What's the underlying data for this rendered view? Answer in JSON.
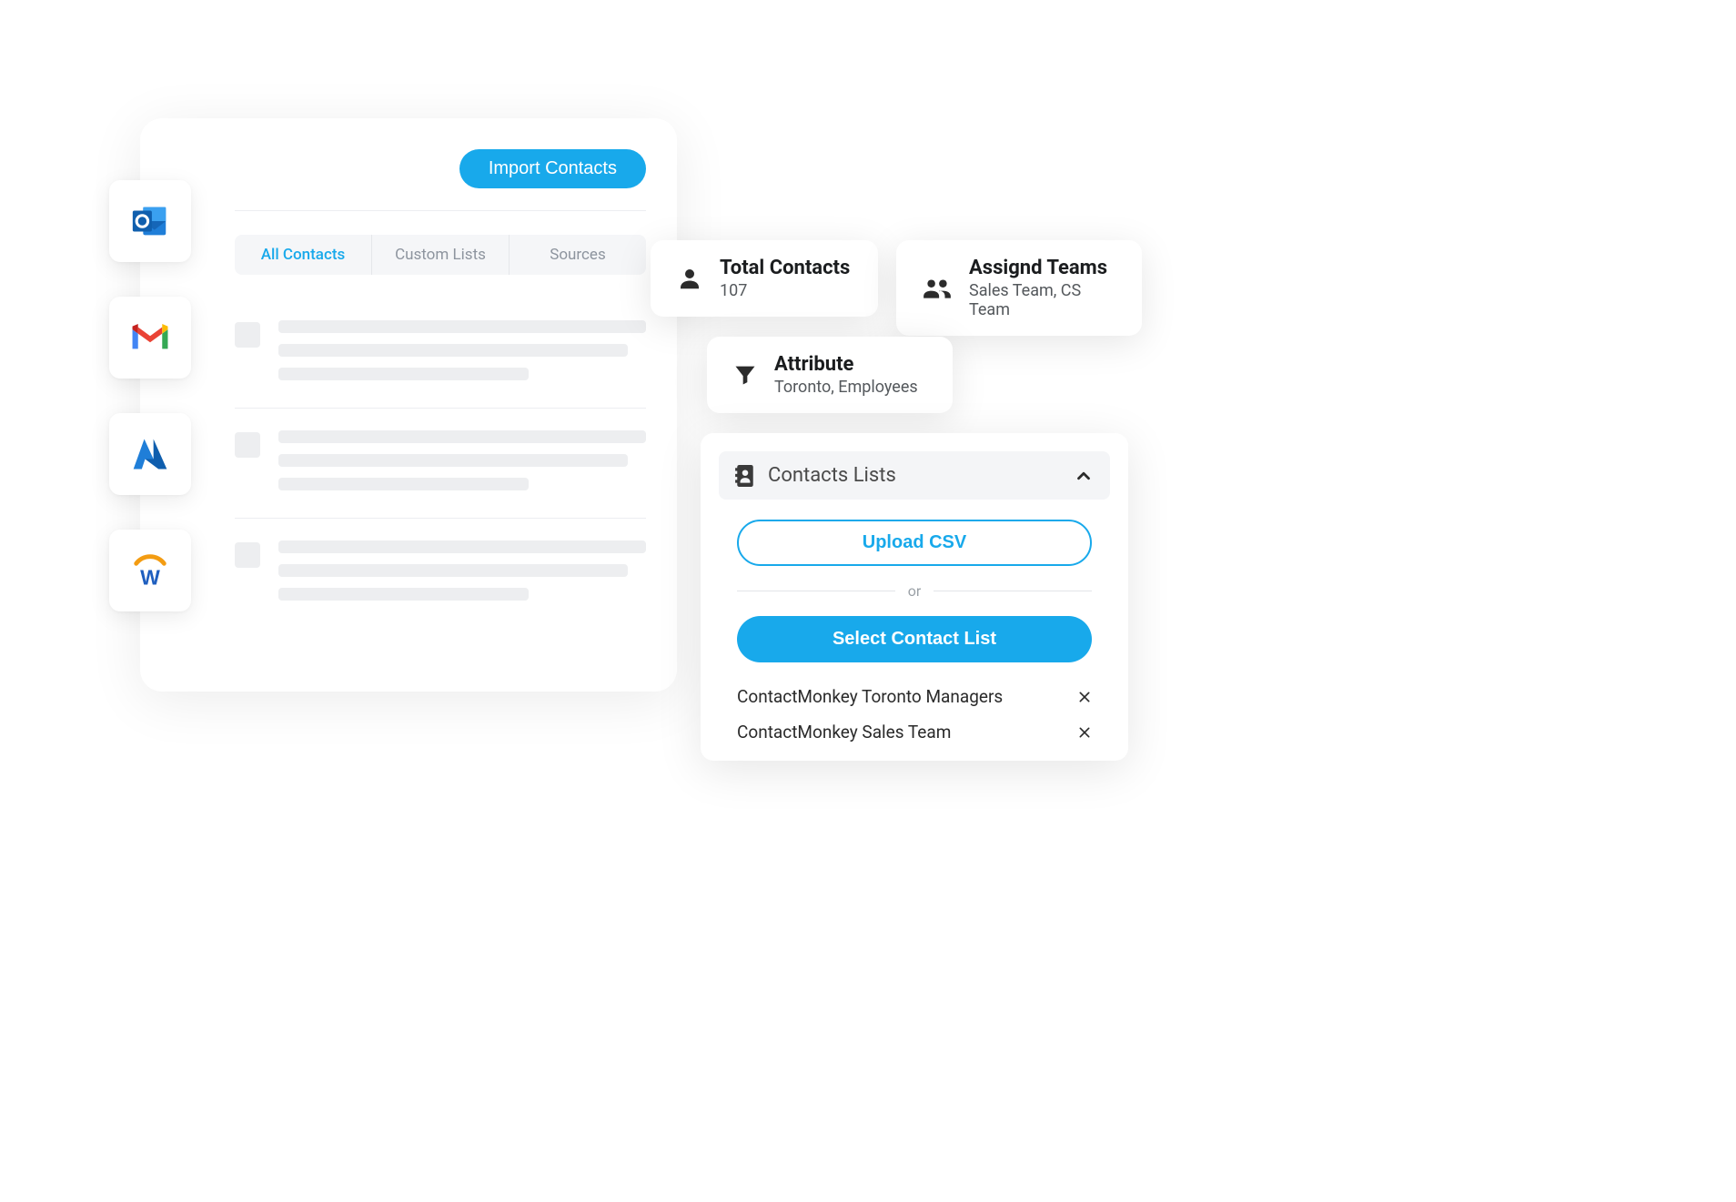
{
  "integrations": [
    {
      "id": "outlook",
      "label": "Outlook"
    },
    {
      "id": "gmail",
      "label": "Gmail"
    },
    {
      "id": "azure",
      "label": "Azure AD"
    },
    {
      "id": "workday",
      "label": "Workday"
    }
  ],
  "panel": {
    "import_label": "Import Contacts",
    "tabs": {
      "all": "All Contacts",
      "custom": "Custom Lists",
      "sources": "Sources"
    }
  },
  "cards": {
    "total": {
      "title": "Total Contacts",
      "value": "107"
    },
    "teams": {
      "title": "Assignd Teams",
      "value": "Sales Team, CS Team"
    },
    "attribute": {
      "title": "Attribute",
      "value": "Toronto, Employees"
    }
  },
  "lists_panel": {
    "header": "Contacts Lists",
    "upload_label": "Upload CSV",
    "or_label": "or",
    "select_label": "Select Contact List",
    "items": [
      "ContactMonkey Toronto Managers",
      "ContactMonkey Sales Team"
    ]
  }
}
